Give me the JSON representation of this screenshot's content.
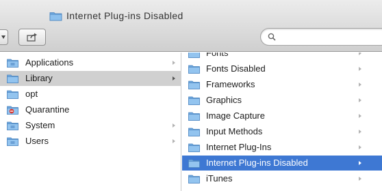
{
  "window": {
    "title": "Internet Plug-ins Disabled"
  },
  "search": {
    "value": ""
  },
  "column1": {
    "items": [
      {
        "label": "Applications",
        "icon": "app-folder-icon",
        "arrow": true
      },
      {
        "label": "Library",
        "icon": "folder-icon",
        "arrow": true,
        "selected": "inactive"
      },
      {
        "label": "opt",
        "icon": "folder-icon",
        "arrow": false
      },
      {
        "label": "Quarantine",
        "icon": "restricted-folder-icon",
        "arrow": false
      },
      {
        "label": "System",
        "icon": "system-folder-icon",
        "arrow": true
      },
      {
        "label": "Users",
        "icon": "users-folder-icon",
        "arrow": true
      }
    ]
  },
  "column2": {
    "items": [
      {
        "label": "Fonts",
        "icon": "folder-icon",
        "arrow": true
      },
      {
        "label": "Fonts Disabled",
        "icon": "folder-icon",
        "arrow": true
      },
      {
        "label": "Frameworks",
        "icon": "folder-icon",
        "arrow": true
      },
      {
        "label": "Graphics",
        "icon": "folder-icon",
        "arrow": true
      },
      {
        "label": "Image Capture",
        "icon": "folder-icon",
        "arrow": true
      },
      {
        "label": "Input Methods",
        "icon": "folder-icon",
        "arrow": true
      },
      {
        "label": "Internet Plug-Ins",
        "icon": "folder-icon",
        "arrow": true
      },
      {
        "label": "Internet Plug-ins Disabled",
        "icon": "folder-icon",
        "arrow": true,
        "selected": "active"
      },
      {
        "label": "iTunes",
        "icon": "folder-icon",
        "arrow": true
      }
    ]
  },
  "colors": {
    "selection_active": "#3e78d3",
    "selection_inactive": "#d0d0d0",
    "folder_blue": "#7fb3e6"
  }
}
